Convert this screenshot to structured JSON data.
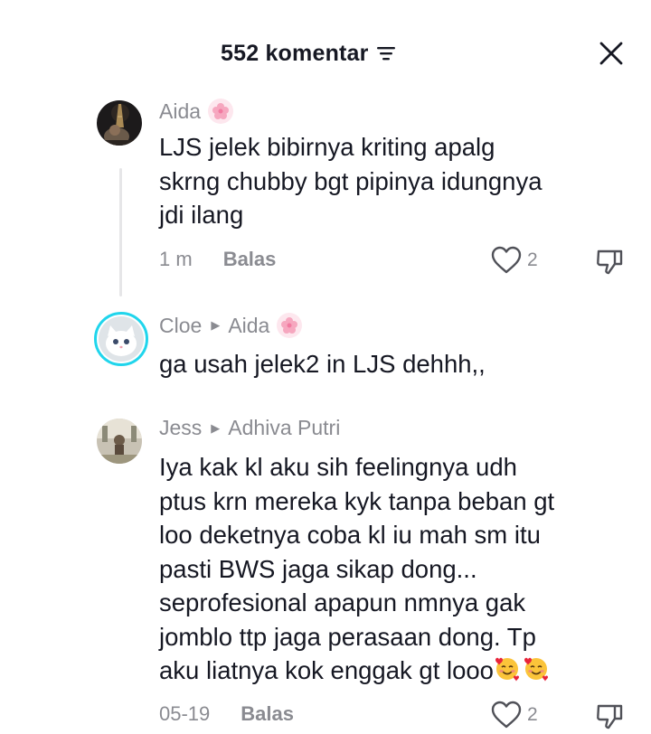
{
  "header": {
    "title": "552 komentar",
    "icons": {
      "filter": "filter-lines-icon",
      "close": "close-x-icon"
    }
  },
  "comments": [
    {
      "username": "Aida",
      "badge_icon": "pink-flower-emoji",
      "text_lines": [
        "LJS jelek bibirnya kriting apalg",
        "skrng chubby bgt pipinya idungnya",
        "jdi ilang"
      ],
      "time": "1 m",
      "reply_label": "Balas",
      "likes": "2"
    },
    {
      "username": "Cloe",
      "reply_to": "Aida",
      "badge_icon": "pink-flower-emoji",
      "text_lines": [
        "ga usah jelek2 in LJS dehhh,,"
      ]
    },
    {
      "username": "Jess",
      "reply_to": "Adhiva Putri",
      "text_lines": [
        "Iya kak kl aku sih feelingnya udh",
        "ptus krn mereka kyk tanpa beban gt",
        "loo deketnya coba kl iu mah sm itu",
        "pasti BWS jaga sikap dong...",
        "seprofesional apapun nmnya gak",
        "jomblo ttp jaga perasaan dong. Tp",
        "aku liatnya kok enggak gt looo"
      ],
      "trailing_emoji": "smiling-face-with-hearts-emoji x2",
      "time": "05-19",
      "reply_label": "Balas",
      "likes": "2"
    }
  ],
  "colors": {
    "text": "#161823",
    "secondary": "#8a8b91",
    "avatar_ring": "#20d5ec"
  }
}
